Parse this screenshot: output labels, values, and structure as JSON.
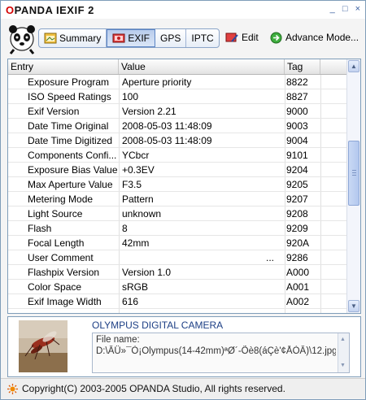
{
  "window": {
    "title_o": "O",
    "title_rest": "PANDA IEXIF 2",
    "controls": [
      "_",
      "□",
      "×"
    ]
  },
  "toolbar": {
    "tabs": [
      {
        "label": "Summary",
        "icon": "summary-icon"
      },
      {
        "label": "EXIF",
        "icon": "exif-icon",
        "active": true
      },
      {
        "label": "GPS"
      },
      {
        "label": "IPTC"
      }
    ],
    "edit_label": "Edit",
    "advanced_label": "Advance Mode..."
  },
  "table": {
    "columns": [
      "Entry",
      "Value",
      "Tag"
    ],
    "rows": [
      {
        "entry": "Exposure Program",
        "value": "Aperture priority",
        "tag": "8822"
      },
      {
        "entry": "ISO Speed Ratings",
        "value": "100",
        "tag": "8827"
      },
      {
        "entry": "Exif Version",
        "value": "Version 2.21",
        "tag": "9000"
      },
      {
        "entry": "Date Time Original",
        "value": "2008-05-03 11:48:09",
        "tag": "9003"
      },
      {
        "entry": "Date Time Digitized",
        "value": "2008-05-03 11:48:09",
        "tag": "9004"
      },
      {
        "entry": "Components Confi...",
        "value": "YCbcr",
        "tag": "9101"
      },
      {
        "entry": "Exposure Bias Value",
        "value": "+0.3EV",
        "tag": "9204"
      },
      {
        "entry": "Max Aperture Value",
        "value": "F3.5",
        "tag": "9205"
      },
      {
        "entry": "Metering Mode",
        "value": "Pattern",
        "tag": "9207"
      },
      {
        "entry": "Light Source",
        "value": "unknown",
        "tag": "9208"
      },
      {
        "entry": "Flash",
        "value": "8",
        "tag": "9209"
      },
      {
        "entry": "Focal Length",
        "value": "42mm",
        "tag": "920A"
      },
      {
        "entry": "User Comment",
        "value": "...",
        "tag": "9286"
      },
      {
        "entry": "Flashpix Version",
        "value": "Version 1.0",
        "tag": "A000"
      },
      {
        "entry": "Color Space",
        "value": "sRGB",
        "tag": "A001"
      },
      {
        "entry": "Exif Image Width",
        "value": "616",
        "tag": "A002"
      }
    ]
  },
  "info": {
    "camera": "OLYMPUS DIGITAL CAMERA",
    "file_label": "File name:",
    "file_path": "D:\\ÂÜ»¯Ò¡Olympus(14-42mm)ªØ´-Õè8(áÇè'¢ÅÒÂ)\\12.jpg"
  },
  "status": {
    "copyright": "Copyright(C) 2003-2005 OPANDA Studio, All rights reserved."
  },
  "colors": {
    "accent": "#d40000",
    "selected_tab": "#b8ccec",
    "link_blue": "#1d3f85"
  }
}
